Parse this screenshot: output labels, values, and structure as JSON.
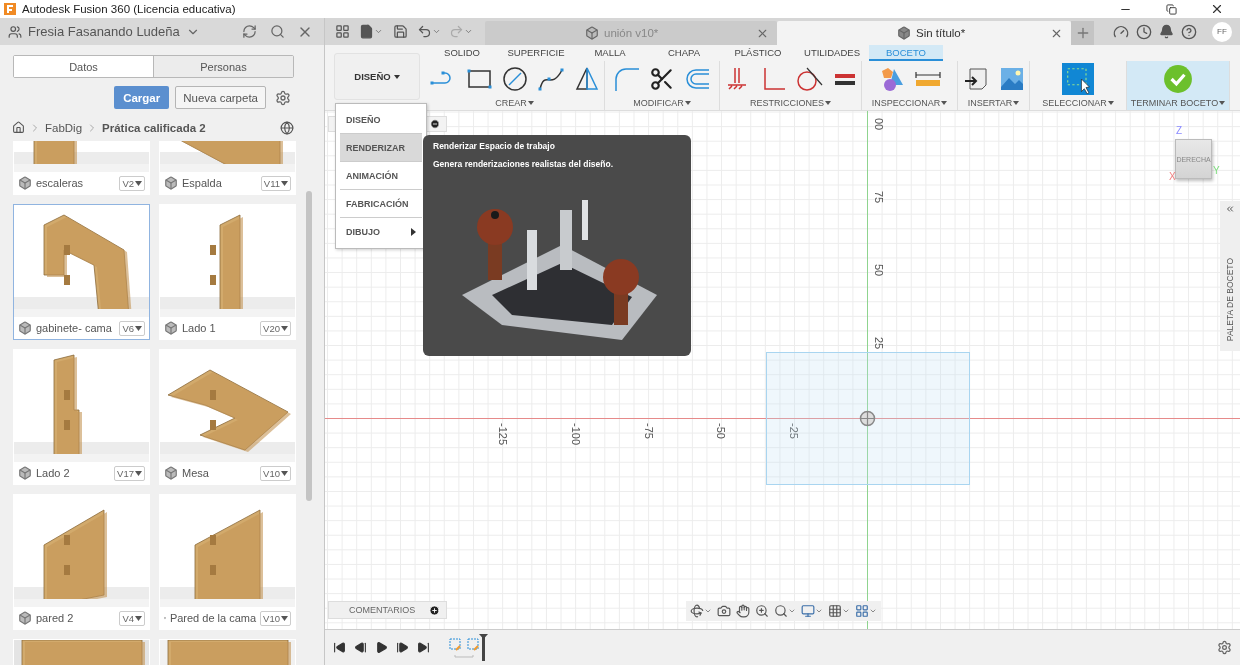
{
  "title_bar": {
    "app_title": "Autodesk Fusion 360 (Licencia educativa)"
  },
  "data_panel": {
    "user": "Fresia Fasanando Ludeña",
    "tabs": [
      {
        "label": "Datos",
        "selected": true
      },
      {
        "label": "Personas",
        "selected": false
      }
    ],
    "upload_button": "Cargar",
    "new_folder_button": "Nueva carpeta",
    "breadcrumb": [
      "FabDig",
      "Prática calificada 2"
    ],
    "files": [
      {
        "kind": "file",
        "name": "escaleras",
        "version": "V2",
        "selected": false
      },
      {
        "kind": "file",
        "name": "Espalda",
        "version": "V11",
        "selected": false
      },
      {
        "kind": "file",
        "name": "gabinete- cama",
        "version": "V6",
        "selected": true
      },
      {
        "kind": "file",
        "name": "Lado 1",
        "version": "V20",
        "selected": false
      },
      {
        "kind": "file",
        "name": "Lado 2",
        "version": "V17",
        "selected": false
      },
      {
        "kind": "file",
        "name": "Mesa",
        "version": "V10",
        "selected": false
      },
      {
        "kind": "file",
        "name": "pared 2",
        "version": "V4",
        "selected": false
      },
      {
        "kind": "file",
        "name": "Pared de la cama",
        "version": "V10",
        "selected": false
      },
      {
        "kind": "cut",
        "selected": false
      },
      {
        "kind": "cut",
        "selected": false
      }
    ]
  },
  "document_tabs": [
    {
      "label": "unión v10*",
      "selected": false
    },
    {
      "label": "Sin título*",
      "selected": true
    }
  ],
  "avatar": "FF",
  "toolbar": {
    "workspace_button": "DISEÑO",
    "tabs": [
      {
        "label": "SOLIDO",
        "selected": false
      },
      {
        "label": "SUPERFICIE",
        "selected": false
      },
      {
        "label": "MALLA",
        "selected": false
      },
      {
        "label": "CHAPA",
        "selected": false
      },
      {
        "label": "PLÁSTICO",
        "selected": false
      },
      {
        "label": "UTILIDADES",
        "selected": false
      },
      {
        "label": "BOCETO",
        "selected": true
      }
    ],
    "groups": [
      {
        "kind": "create",
        "label": "CREAR"
      },
      {
        "kind": "modify",
        "label": "MODIFICAR"
      },
      {
        "kind": "constraints",
        "label": "RESTRICCIONES"
      },
      {
        "kind": "inspect",
        "label": "INSPECCIONAR"
      },
      {
        "kind": "insert",
        "label": "INSERTAR"
      },
      {
        "kind": "select",
        "label": "SELECCIONAR"
      },
      {
        "kind": "finish",
        "label": "TERMINAR BOCETO"
      }
    ]
  },
  "workspace_menu": [
    {
      "label": "DISEÑO",
      "highlighted": false,
      "submenu": false
    },
    {
      "label": "RENDERIZAR",
      "highlighted": true,
      "submenu": false
    },
    {
      "label": "ANIMACIÓN",
      "highlighted": false,
      "submenu": false
    },
    {
      "label": "FABRICACIÓN",
      "highlighted": false,
      "submenu": false
    },
    {
      "label": "DIBUJO",
      "highlighted": false,
      "submenu": true
    }
  ],
  "tooltip": {
    "title": "Renderizar Espacio de trabajo",
    "description": "Genera renderizaciones realistas del diseño."
  },
  "canvas": {
    "vertical_ticks": [
      "00",
      "75",
      "50",
      "25"
    ],
    "horizontal_ticks": [
      "-125",
      "-100",
      "-75",
      "-50",
      "-25"
    ],
    "view_cube": {
      "face": "DERECHA",
      "axes": [
        "Z",
        "Y",
        "X"
      ]
    },
    "sketch_palette": "PALETA DE BOCETO",
    "comments": "COMENTARIOS"
  }
}
